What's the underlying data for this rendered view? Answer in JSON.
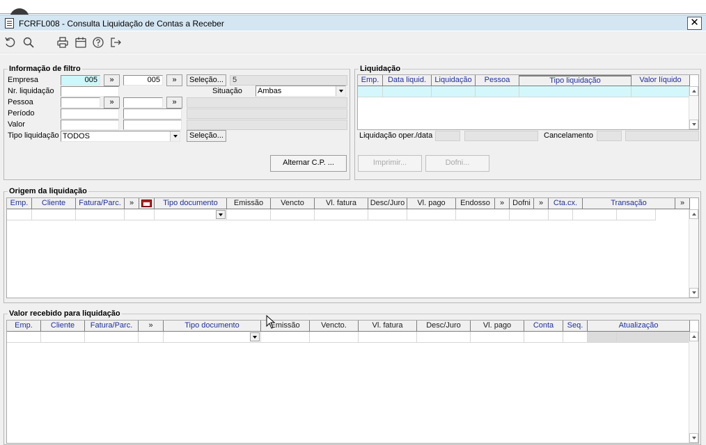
{
  "window": {
    "title": "FCRFL008 - Consulta Liquidação de Contas a Receber",
    "close_label": "✕"
  },
  "toolbar": {
    "buttons": [
      "undo-icon",
      "search-icon",
      "print-icon",
      "calendar-icon",
      "help-icon",
      "exit-icon"
    ]
  },
  "filtro": {
    "legend": "Informação de filtro",
    "empresa_label": "Empresa",
    "empresa_from": "005",
    "empresa_to": "005",
    "empresa_extra": "5",
    "nr_liquidacao_label": "Nr. liquidação",
    "situacao_label": "Situação",
    "situacao_value": "Ambas",
    "pessoa_label": "Pessoa",
    "periodo_label": "Período",
    "valor_label": "Valor",
    "tipo_liquidacao_label": "Tipo liquidação",
    "tipo_liquidacao_value": "TODOS",
    "more_label": "»",
    "selecao_label": "Seleção...",
    "alternar_label": "Alternar C.P. ..."
  },
  "liquidacao": {
    "legend": "Liquidação",
    "columns": [
      "Emp.",
      "Data liquid.",
      "Liquidação",
      "Pessoa",
      "Tipo liquidação",
      "Valor líquido"
    ],
    "oper_data_label": "Liquidação oper./data",
    "cancelamento_label": "Cancelamento",
    "imprimir_label": "Imprimir...",
    "dofni_label": "Dofni..."
  },
  "origem": {
    "legend": "Origem da liquidação",
    "columns": [
      "Emp.",
      "Cliente",
      "Fatura/Parc.",
      "»",
      "",
      "Tipo documento",
      "Emissão",
      "Vencto",
      "Vl. fatura",
      "Desc/Juro",
      "Vl. pago",
      "Endosso",
      "»",
      "Dofni",
      "»",
      "Cta.cx.",
      "Transação",
      "»"
    ]
  },
  "recebido": {
    "legend": "Valor recebido para liquidação",
    "columns": [
      "Emp.",
      "Cliente",
      "Fatura/Parc.",
      "»",
      "Tipo documento",
      "Emissão",
      "Vencto.",
      "Vl. fatura",
      "Desc/Juro",
      "Vl. pago",
      "Conta",
      "Seq.",
      "Atualização"
    ]
  },
  "colors": {
    "title_bar": "#d5e6f3",
    "highlight_input": "#cdf7fb",
    "header_blue": "#1e2f9c"
  }
}
